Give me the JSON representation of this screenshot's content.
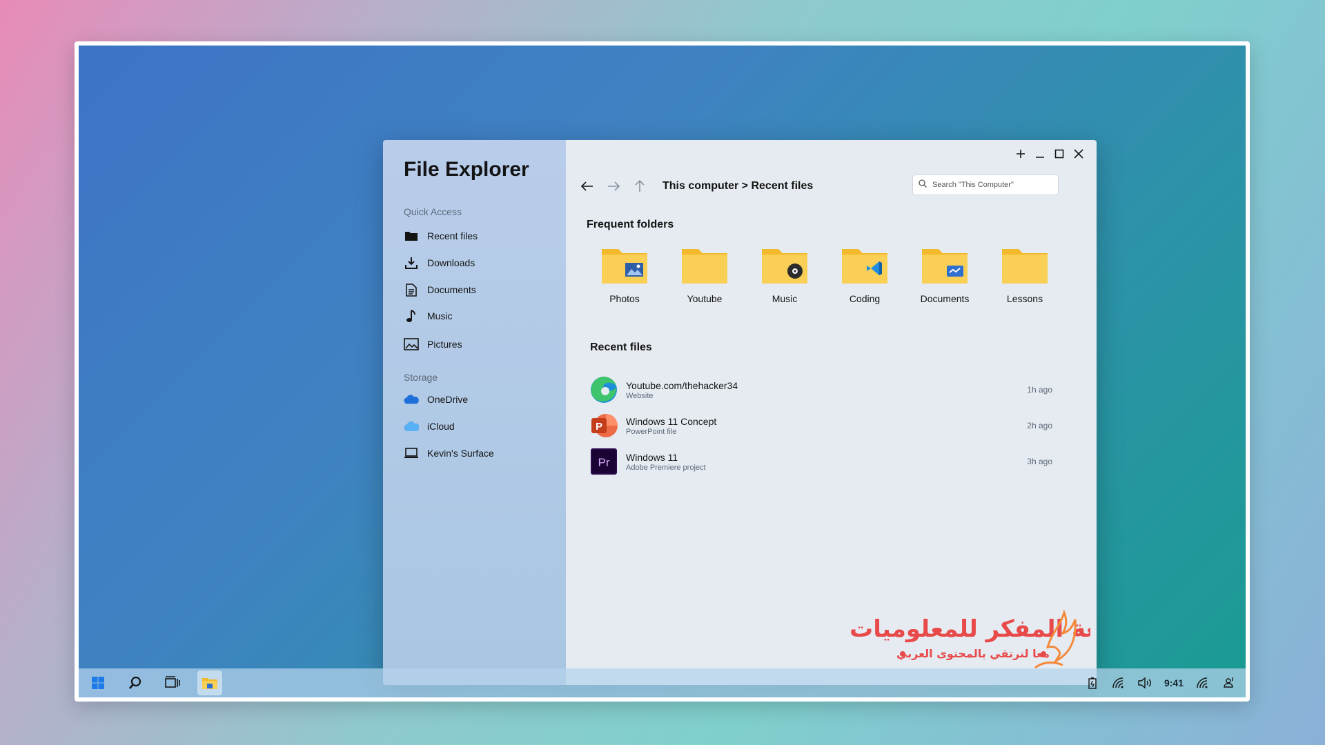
{
  "app": {
    "title": "File Explorer"
  },
  "sidebar": {
    "quick_access_label": "Quick Access",
    "quick_access": [
      {
        "label": "Recent files",
        "icon": "folder-icon"
      },
      {
        "label": "Downloads",
        "icon": "download-icon"
      },
      {
        "label": "Documents",
        "icon": "document-icon"
      },
      {
        "label": "Music",
        "icon": "music-note-icon"
      },
      {
        "label": "Pictures",
        "icon": "picture-icon"
      }
    ],
    "storage_label": "Storage",
    "storage": [
      {
        "label": "OneDrive",
        "icon": "onedrive-cloud-icon"
      },
      {
        "label": "iCloud",
        "icon": "icloud-icon"
      },
      {
        "label": "Kevin's Surface",
        "icon": "laptop-icon"
      }
    ]
  },
  "toolbar": {
    "breadcrumb": "This computer > Recent files",
    "search_placeholder": "Search \"This Computer\""
  },
  "frequent_folders": {
    "heading": "Frequent folders",
    "items": [
      {
        "label": "Photos",
        "badge": "photo"
      },
      {
        "label": "Youtube",
        "badge": "none"
      },
      {
        "label": "Music",
        "badge": "music"
      },
      {
        "label": "Coding",
        "badge": "vscode"
      },
      {
        "label": "Documents",
        "badge": "doc"
      },
      {
        "label": "Lessons",
        "badge": "none"
      }
    ]
  },
  "recent_files": {
    "heading": "Recent files",
    "items": [
      {
        "name": "Youtube.com/thehacker34",
        "type": "Website",
        "time": "1h ago",
        "icon": "edge-browser-icon"
      },
      {
        "name": "Windows 11 Concept",
        "type": "PowerPoint file",
        "time": "2h ago",
        "icon": "powerpoint-icon"
      },
      {
        "name": "Windows 11",
        "type": "Adobe Premiere project",
        "time": "3h ago",
        "icon": "premiere-pro-icon"
      }
    ]
  },
  "taskbar": {
    "time": "9:41"
  },
  "watermark": {
    "title": "قلعة المفكر للمعلوميات",
    "subtitle": "معا لنرتقي بالمحتوى العربي"
  },
  "colors": {
    "folder": "#f7c948",
    "accent": "#2f6fd0",
    "sidebar": "#b3cbe8",
    "main": "#e6ebf2"
  }
}
